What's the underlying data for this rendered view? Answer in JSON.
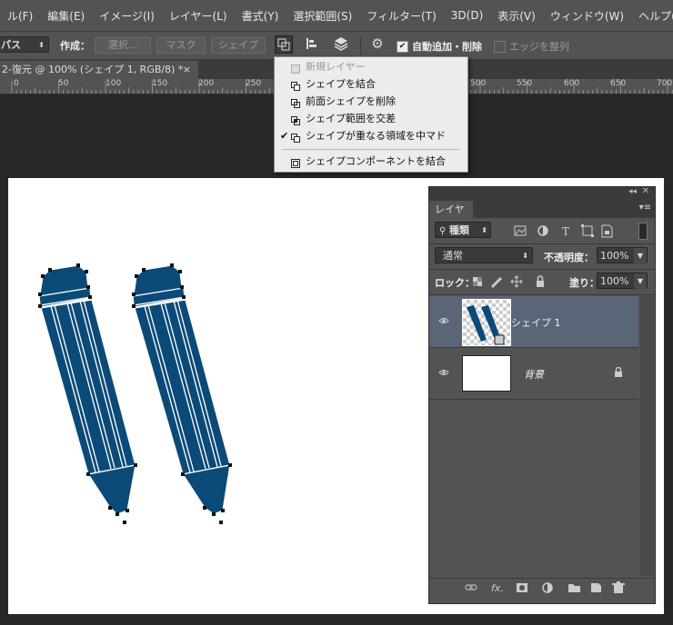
{
  "menu": [
    "ル(F)",
    "編集(E)",
    "イメージ(I)",
    "レイヤー(L)",
    "書式(Y)",
    "選択範囲(S)",
    "フィルター(T)",
    "3D(D)",
    "表示(V)",
    "ウィンドウ(W)",
    "ヘルプ(H)"
  ],
  "options": {
    "mode_select": "パス",
    "create_label": "作成：",
    "select_button": "選択...",
    "mask_button": "マスク",
    "shape_button": "シェイプ",
    "auto_add_delete_label": "自動追加・削除",
    "auto_add_delete_checked": true,
    "align_edges_label": "エッジを整列",
    "align_edges_checked": false
  },
  "document_tab": {
    "title": "2-復元 @ 100% (シェイプ 1, RGB/8) *",
    "close": "×"
  },
  "ruler_ticks": [
    "0",
    "50",
    "100",
    "150",
    "200",
    "250",
    "500",
    "550",
    "600",
    "650",
    "700"
  ],
  "path_operations_menu": {
    "items": [
      {
        "label": "新規レイヤー",
        "disabled": true,
        "checked": false
      },
      {
        "label": "シェイプを結合",
        "disabled": false,
        "checked": false
      },
      {
        "label": "前面シェイプを削除",
        "disabled": false,
        "checked": false
      },
      {
        "label": "シェイプ範囲を交差",
        "disabled": false,
        "checked": false
      },
      {
        "label": "シェイプが重なる領域を中マド",
        "disabled": false,
        "checked": true
      },
      {
        "label": "シェイプコンポーネントを結合",
        "disabled": false,
        "checked": false
      }
    ],
    "check_mark": "✔"
  },
  "layers_panel": {
    "tab": "レイヤー",
    "filter_kind": "種類",
    "blend_mode": "通常",
    "opacity_label": "不透明度：",
    "opacity_value": "100%",
    "lock_label": "ロック：",
    "fill_label": "塗り：",
    "fill_value": "100%",
    "layers": [
      {
        "name": "シェイプ 1",
        "selected": true,
        "visible": true
      },
      {
        "name": "背景",
        "selected": false,
        "visible": true,
        "locked": true
      }
    ]
  },
  "colors": {
    "pencil_fill": "#0b4a78",
    "pencil_stroke": "#ffffff",
    "selected_layer": "#5a6577"
  }
}
